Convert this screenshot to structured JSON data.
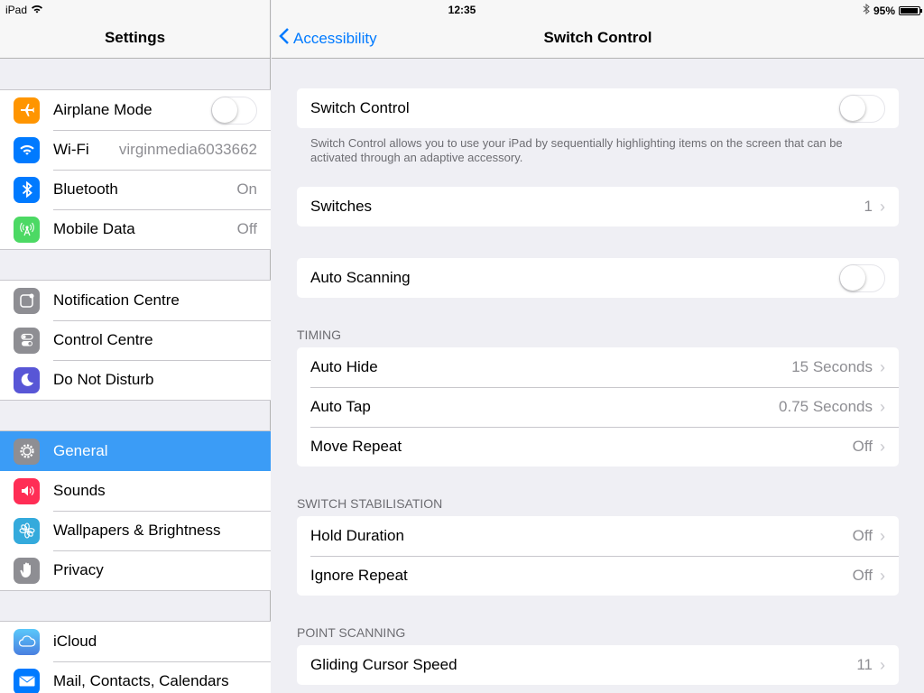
{
  "status_bar": {
    "device": "iPad",
    "time": "12:35",
    "battery": "95%",
    "battery_level": 0.95
  },
  "master": {
    "title": "Settings",
    "groups": [
      {
        "items": [
          {
            "label": "Airplane Mode",
            "icon": "airplane-icon",
            "color": "#ff9500",
            "toggle": false
          },
          {
            "label": "Wi-Fi",
            "icon": "wifi-icon",
            "color": "#007aff",
            "value": "virginmedia6033662"
          },
          {
            "label": "Bluetooth",
            "icon": "bluetooth-icon",
            "color": "#007aff",
            "value": "On"
          },
          {
            "label": "Mobile Data",
            "icon": "antenna-icon",
            "color": "#4cd964",
            "value": "Off"
          }
        ]
      },
      {
        "items": [
          {
            "label": "Notification Centre",
            "icon": "notification-icon",
            "color": "#8e8e93"
          },
          {
            "label": "Control Centre",
            "icon": "control-centre-icon",
            "color": "#8e8e93"
          },
          {
            "label": "Do Not Disturb",
            "icon": "moon-icon",
            "color": "#5856d6"
          }
        ]
      },
      {
        "items": [
          {
            "label": "General",
            "icon": "gear-icon",
            "color": "#8e8e93",
            "selected": true
          },
          {
            "label": "Sounds",
            "icon": "speaker-icon",
            "color": "#ff2d55"
          },
          {
            "label": "Wallpapers & Brightness",
            "icon": "flower-icon",
            "color": "#34aadc"
          },
          {
            "label": "Privacy",
            "icon": "hand-icon",
            "color": "#8e8e93"
          }
        ]
      },
      {
        "items": [
          {
            "label": "iCloud",
            "icon": "cloud-icon",
            "color": "#5ac8fa"
          },
          {
            "label": "Mail, Contacts, Calendars",
            "icon": "mail-icon",
            "color": "#007aff"
          }
        ]
      }
    ]
  },
  "detail": {
    "back_label": "Accessibility",
    "title": "Switch Control",
    "switch_control": {
      "label": "Switch Control",
      "toggle": false
    },
    "switch_control_footer": "Switch Control allows you to use your iPad by sequentially highlighting items on the screen that can be activated through an adaptive accessory.",
    "switches": {
      "label": "Switches",
      "value": "1"
    },
    "auto_scanning": {
      "label": "Auto Scanning",
      "toggle": false
    },
    "timing_header": "TIMING",
    "timing": [
      {
        "label": "Auto Hide",
        "value": "15 Seconds"
      },
      {
        "label": "Auto Tap",
        "value": "0.75 Seconds"
      },
      {
        "label": "Move Repeat",
        "value": "Off"
      }
    ],
    "stabilisation_header": "SWITCH STABILISATION",
    "stabilisation": [
      {
        "label": "Hold Duration",
        "value": "Off"
      },
      {
        "label": "Ignore Repeat",
        "value": "Off"
      }
    ],
    "point_scanning_header": "POINT SCANNING",
    "point_scanning": [
      {
        "label": "Gliding Cursor Speed",
        "value": "11"
      }
    ]
  },
  "colors": {
    "accent": "#007aff",
    "selected_row": "#3b9cf6",
    "background": "#efeff4"
  }
}
